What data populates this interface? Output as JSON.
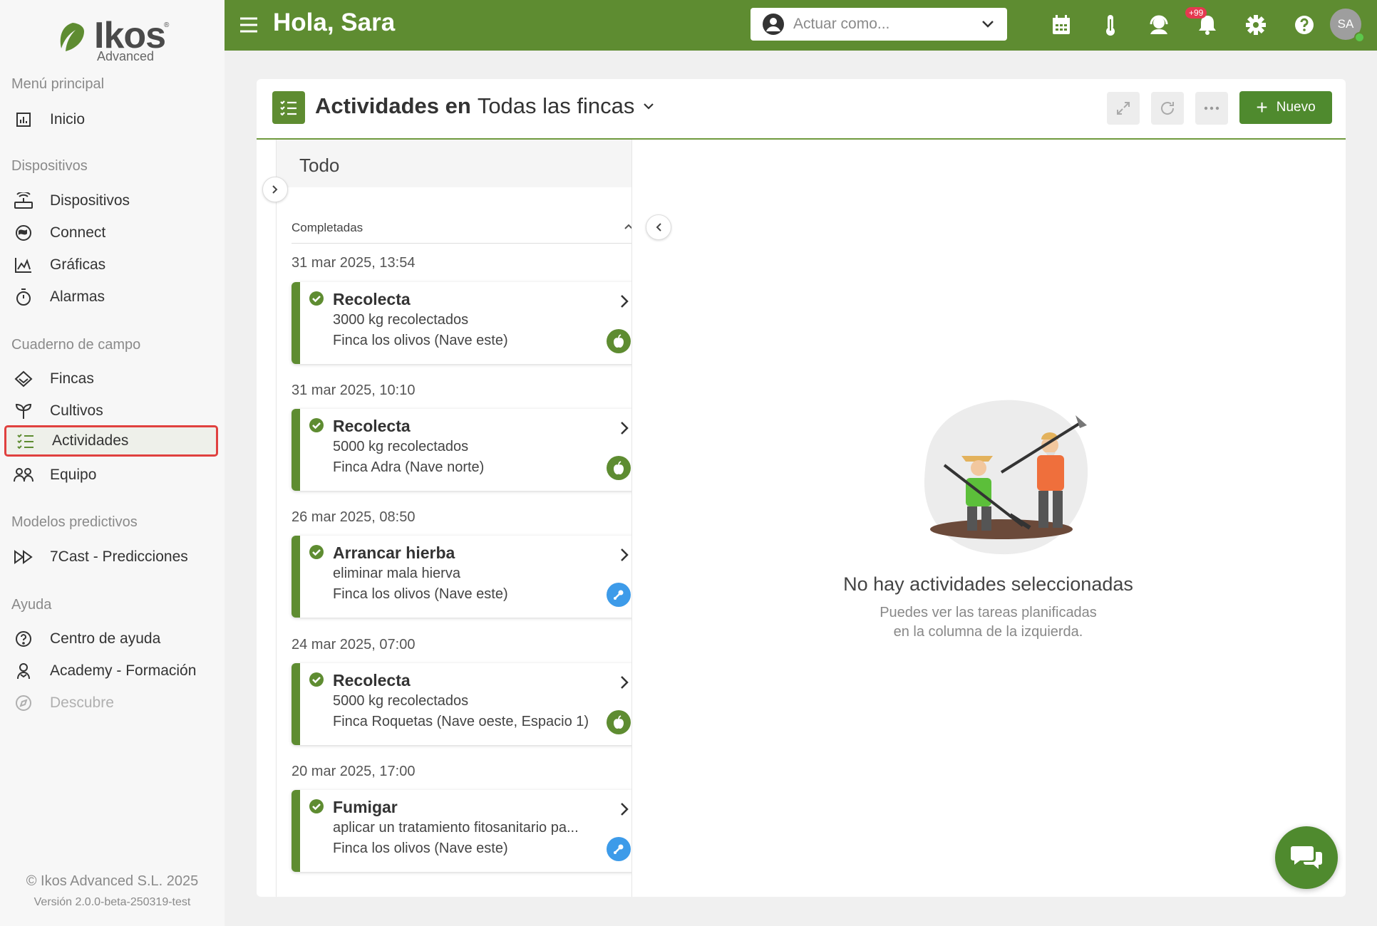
{
  "brand": {
    "name": "Ikos",
    "sub": "Advanced",
    "reg": "®"
  },
  "sidebar": {
    "sections": [
      {
        "title": "Menú principal",
        "items": [
          {
            "label": "Inicio",
            "icon": "chart-bar-icon"
          }
        ]
      },
      {
        "title": "Dispositivos",
        "items": [
          {
            "label": "Dispositivos",
            "icon": "router-icon"
          },
          {
            "label": "Connect",
            "icon": "connect-icon"
          },
          {
            "label": "Gráficas",
            "icon": "area-chart-icon"
          },
          {
            "label": "Alarmas",
            "icon": "stopwatch-icon"
          }
        ]
      },
      {
        "title": "Cuaderno de campo",
        "items": [
          {
            "label": "Fincas",
            "icon": "layers-icon"
          },
          {
            "label": "Cultivos",
            "icon": "sprout-icon"
          },
          {
            "label": "Actividades",
            "icon": "task-list-icon",
            "active": true
          },
          {
            "label": "Equipo",
            "icon": "team-icon"
          }
        ]
      },
      {
        "title": "Modelos predictivos",
        "items": [
          {
            "label": "7Cast - Predicciones",
            "icon": "fast-forward-icon"
          }
        ]
      },
      {
        "title": "Ayuda",
        "items": [
          {
            "label": "Centro de ayuda",
            "icon": "help-circle-icon"
          },
          {
            "label": "Academy - Formación",
            "icon": "graduation-icon"
          },
          {
            "label": "Descubre",
            "icon": "compass-icon",
            "disabled": true
          }
        ]
      }
    ],
    "copyright": "© Ikos Advanced S.L. 2025",
    "version": "Versión 2.0.0-beta-250319-test"
  },
  "topbar": {
    "greeting": "Hola, Sara",
    "act_as_placeholder": "Actuar como...",
    "notification_badge": "+99",
    "avatar_initials": "SA",
    "icons": [
      "calendar-icon",
      "thermometer-icon",
      "support-icon",
      "bell-icon",
      "gear-icon",
      "help-icon"
    ]
  },
  "panel": {
    "title_bold": "Actividades en",
    "title_scope": "Todas las fincas",
    "new_button": "Nuevo",
    "column_title": "Todo",
    "group_label": "Completadas",
    "activities": [
      {
        "date": "31 mar 2025, 13:54",
        "title": "Recolecta",
        "detail": "3000 kg recolectados",
        "location": "Finca los olivos (Nave este)",
        "type": "harvest"
      },
      {
        "date": "31 mar 2025, 10:10",
        "title": "Recolecta",
        "detail": "5000 kg recolectados",
        "location": "Finca Adra (Nave norte)",
        "type": "harvest"
      },
      {
        "date": "26 mar 2025, 08:50",
        "title": "Arrancar hierba",
        "detail": "eliminar mala hierva",
        "location": "Finca los olivos (Nave este)",
        "type": "tool"
      },
      {
        "date": "24 mar 2025, 07:00",
        "title": "Recolecta",
        "detail": "5000 kg recolectados",
        "location": "Finca Roquetas (Nave oeste, Espacio 1)",
        "type": "harvest"
      },
      {
        "date": "20 mar 2025, 17:00",
        "title": "Fumigar",
        "detail": "aplicar un tratamiento fitosanitario pa...",
        "location": "Finca los olivos (Nave este)",
        "type": "tool"
      }
    ],
    "empty_title": "No hay actividades seleccionadas",
    "empty_sub_1": "Puedes ver las tareas planificadas",
    "empty_sub_2": "en la columna de la izquierda."
  },
  "colors": {
    "primary": "#5e8c31",
    "accent_button": "#4f8a2e",
    "active_outline": "#e0413f",
    "tool_tag": "#3d9be9",
    "badge": "#e53950"
  }
}
